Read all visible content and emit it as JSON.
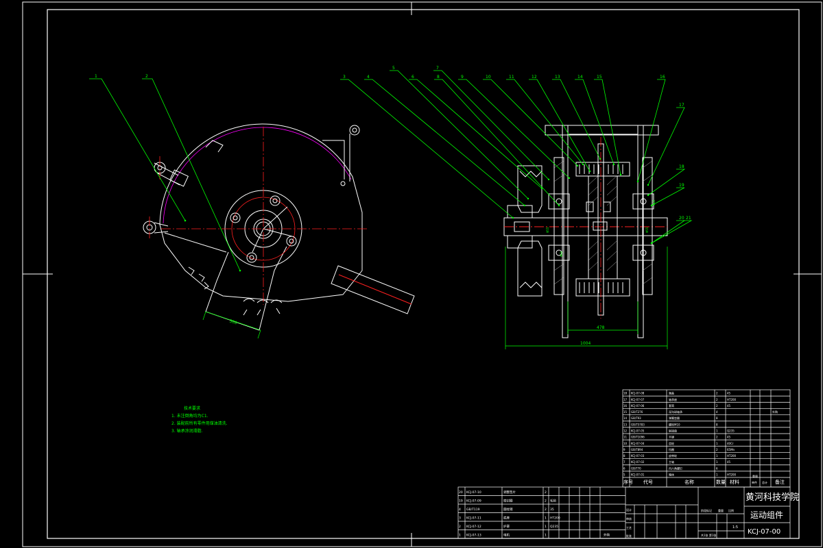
{
  "colors": {
    "background": "#000000",
    "frame": "#ffffff",
    "part": "#ffffff",
    "leader": "#00ff00",
    "centerline": "#ff2020",
    "dimension": "#00ff00",
    "note": "#00ff00",
    "contour": "#ff00ff",
    "section": "#ffffff",
    "hatch": "#cccccc",
    "label": "#ffffff"
  },
  "drawing": {
    "callouts_left": [
      "1",
      "2"
    ],
    "callouts_right": [
      "3",
      "4",
      "5",
      "6",
      "7",
      "8",
      "9",
      "10",
      "11",
      "12",
      "13",
      "14",
      "15",
      "16",
      "17",
      "18",
      "19",
      "20",
      "21"
    ],
    "dimension_left": "300",
    "dimension_hub": "478",
    "dimension_overall": "1004"
  },
  "notes": {
    "title": "技术要求",
    "lines": [
      "1. 未注倒角均为C1.",
      "2. 装配前所有零件用煤油清洗.",
      "3. 轴承涂润滑脂."
    ]
  },
  "bom": {
    "header": [
      "序号",
      "代号",
      "名称",
      "数量",
      "材料",
      "单件",
      "总计",
      "备注"
    ],
    "header_weight": "重量",
    "rows": [
      [
        "18",
        "KCJ-07-08",
        "端盖",
        "2",
        "45",
        "",
        "",
        ""
      ],
      [
        "17",
        "KCJ-07-07",
        "轴承座",
        "2",
        "HT200",
        "",
        "",
        ""
      ],
      [
        "16",
        "KCJ-07-06",
        "套筒",
        "2",
        "45",
        "",
        "",
        ""
      ],
      [
        "15",
        "GB/T276",
        "深沟球轴承",
        "4",
        "",
        "",
        "",
        "外购"
      ],
      [
        "14",
        "GB/T93",
        "弹簧垫圈",
        "8",
        "",
        "",
        "",
        ""
      ],
      [
        "13",
        "GB/T5783",
        "螺栓M10",
        "8",
        "",
        "",
        "",
        ""
      ],
      [
        "12",
        "KCJ-07-05",
        "联接盘",
        "1",
        "Q235",
        "",
        "",
        ""
      ],
      [
        "11",
        "GB/T1096",
        "平键",
        "2",
        "45",
        "",
        "",
        ""
      ],
      [
        "10",
        "KCJ-07-04",
        "齿轮",
        "1",
        "40Cr",
        "",
        "",
        ""
      ],
      [
        "9",
        "GB/T894",
        "挡圈",
        "2",
        "65Mn",
        "",
        "",
        ""
      ],
      [
        "8",
        "KCJ-07-03",
        "皮带轮",
        "1",
        "HT200",
        "",
        "",
        ""
      ],
      [
        "7",
        "KCJ-07-02",
        "主轴",
        "1",
        "45",
        "",
        "",
        ""
      ],
      [
        "6",
        "GB/T70",
        "内六角螺钉",
        "6",
        "",
        "",
        "",
        ""
      ],
      [
        "5",
        "KCJ-07-01",
        "箱体",
        "1",
        "HT200",
        "",
        "",
        ""
      ]
    ]
  },
  "title_block": {
    "school": "黄河科技学院",
    "drawing_name": "运动组件",
    "drawing_code": "KCJ-07-00",
    "scale_label": "比例",
    "scale": "1:5",
    "sheet": "共1张 第1张",
    "designer_label": "设计",
    "checker_label": "审核",
    "approve_label": "批准",
    "process_label": "工艺",
    "stage_label": "阶段标记",
    "weight_label": "重量",
    "rows": [
      [
        "20",
        "KCJ-07-10",
        "调整垫片",
        "2",
        "",
        ""
      ],
      [
        "19",
        "KCJ-07-09",
        "密封圈",
        "2",
        "毛毡",
        ""
      ],
      [
        "4",
        "GB/T119",
        "圆柱销",
        "2",
        "35",
        ""
      ],
      [
        "3",
        "KCJ-07-11",
        "底座",
        "1",
        "HT200",
        ""
      ],
      [
        "2",
        "KCJ-07-12",
        "护罩",
        "1",
        "Q235",
        ""
      ],
      [
        "1",
        "KCJ-07-13",
        "电机",
        "1",
        "",
        "外购"
      ]
    ]
  }
}
